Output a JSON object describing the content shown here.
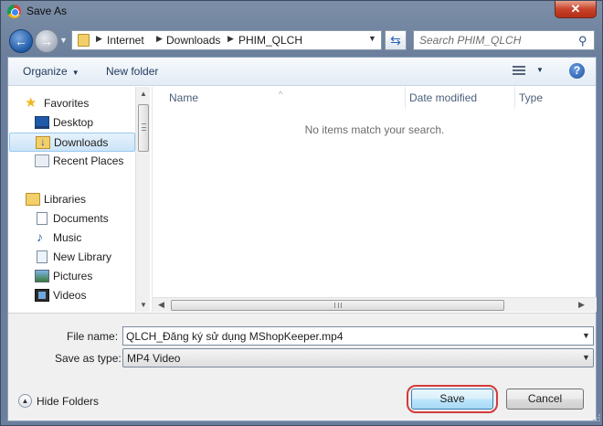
{
  "window": {
    "title": "Save As"
  },
  "address_bar": {
    "crumbs": [
      "Internet",
      "Downloads",
      "PHIM_QLCH"
    ]
  },
  "search": {
    "placeholder": "Search PHIM_QLCH"
  },
  "toolbar": {
    "organize_label": "Organize",
    "new_folder_label": "New folder"
  },
  "nav_pane": {
    "favorites_label": "Favorites",
    "favorites": [
      {
        "label": "Desktop",
        "icon": "desktop-icon"
      },
      {
        "label": "Downloads",
        "icon": "downloads-folder-icon",
        "selected": true
      },
      {
        "label": "Recent Places",
        "icon": "recent-places-icon"
      }
    ],
    "libraries_label": "Libraries",
    "libraries": [
      {
        "label": "Documents",
        "icon": "documents-icon"
      },
      {
        "label": "Music",
        "icon": "music-icon"
      },
      {
        "label": "New Library",
        "icon": "new-library-icon"
      },
      {
        "label": "Pictures",
        "icon": "pictures-icon"
      },
      {
        "label": "Videos",
        "icon": "videos-icon"
      }
    ]
  },
  "file_list": {
    "columns": [
      "Name",
      "Date modified",
      "Type"
    ],
    "empty_message": "No items match your search."
  },
  "form": {
    "file_name_label": "File name:",
    "file_name_value": "QLCH_Đăng ký sử dụng MShopKeeper.mp4",
    "save_as_type_label": "Save as type:",
    "save_as_type_value": "MP4 Video"
  },
  "footer": {
    "hide_folders_label": "Hide Folders",
    "save_label": "Save",
    "cancel_label": "Cancel"
  },
  "colors": {
    "accent": "#3c7fb1",
    "highlight_ring": "#d23b3b",
    "selected_bg": "#cce4f8"
  }
}
